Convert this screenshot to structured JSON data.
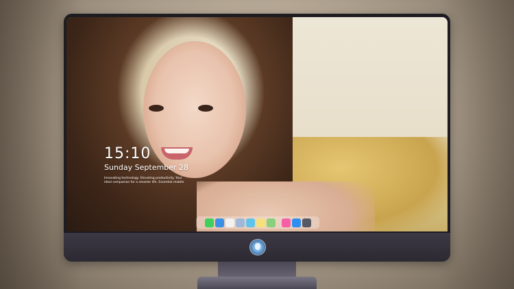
{
  "lockscreen": {
    "time": "15:10",
    "date": "Sunday September 28",
    "tagline": "Innovating technology. Elevating productivity. Your ideal companion for a smarter life. Essential mobile"
  },
  "dock": {
    "icons": [
      {
        "name": "messages",
        "color": "#3fcf5a"
      },
      {
        "name": "finder",
        "color": "#3c8fe6"
      },
      {
        "name": "safari",
        "color": "#f2f2f2"
      },
      {
        "name": "photos",
        "color": "#9fb7d9"
      },
      {
        "name": "files",
        "color": "#5fc4ea"
      },
      {
        "name": "notes",
        "color": "#f6e07a"
      },
      {
        "name": "maps",
        "color": "#8ad07b"
      },
      {
        "name": "music",
        "color": "#f45fa5"
      },
      {
        "name": "app-store",
        "color": "#2f8ff0"
      },
      {
        "name": "camera",
        "color": "#565a64"
      }
    ]
  }
}
